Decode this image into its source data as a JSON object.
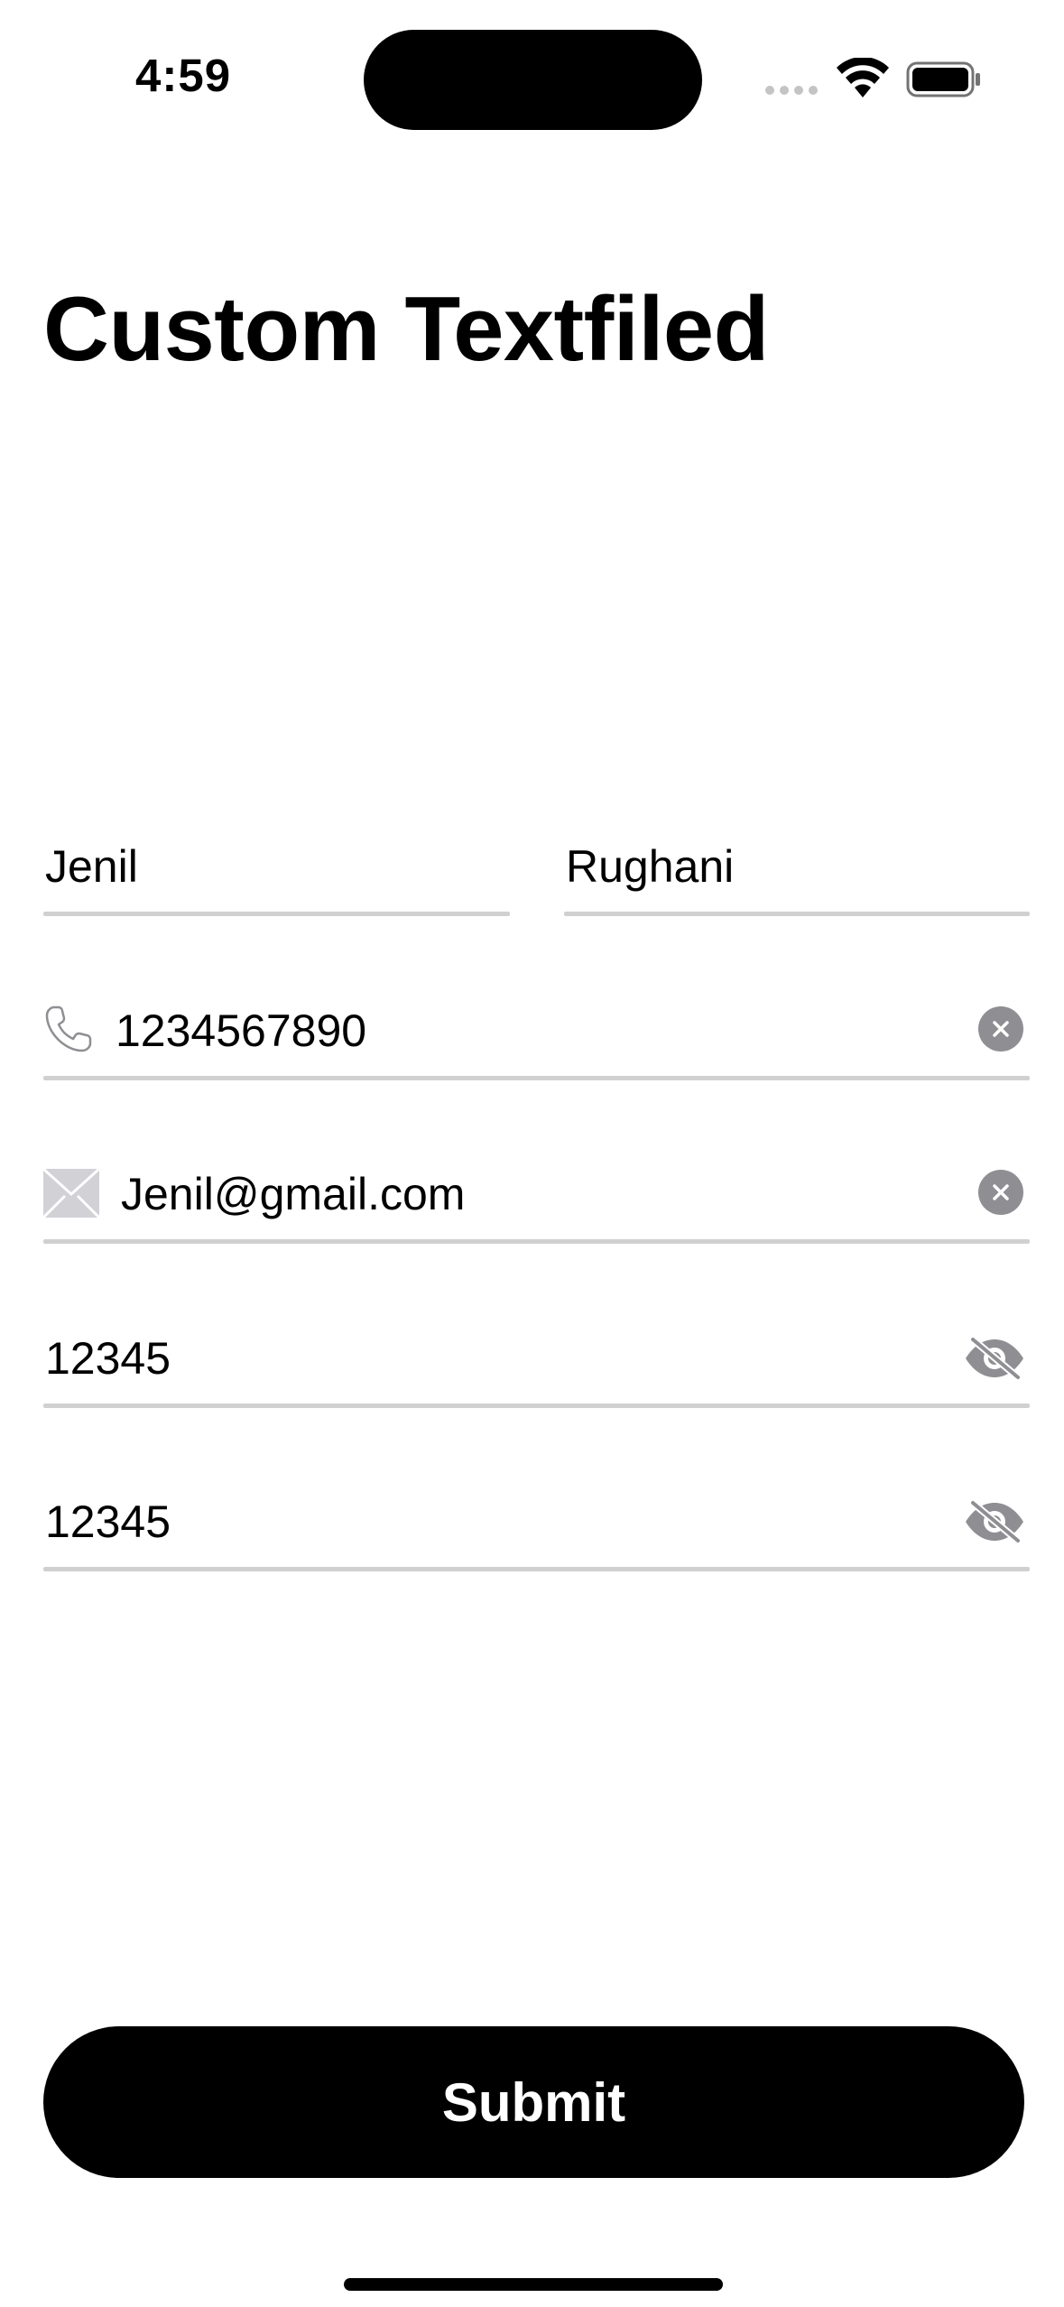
{
  "status_bar": {
    "time": "4:59"
  },
  "header": {
    "title": "Custom Textfiled"
  },
  "form": {
    "first_name": "Jenil",
    "last_name": "Rughani",
    "phone": "1234567890",
    "email": "Jenil@gmail.com",
    "password": "12345",
    "confirm_password": "12345"
  },
  "actions": {
    "submit_label": "Submit"
  },
  "icons": {
    "phone": "phone-icon",
    "email": "envelope-icon",
    "clear": "clear-circle-icon",
    "visibility": "eye-slash-icon"
  },
  "colors": {
    "button_bg": "#000000",
    "underline": "#d0d0d0",
    "icon_gray": "#8e8e93"
  }
}
